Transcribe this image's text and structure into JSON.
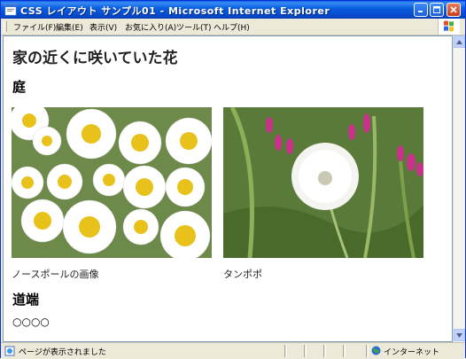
{
  "window": {
    "title": "CSS レイアウト サンプル01 - Microsoft Internet Explorer"
  },
  "menu": {
    "items": [
      "ファイル(F)",
      "編集(E)",
      "表示(V)",
      "お気に入り(A)",
      "ツール(T)",
      "ヘルプ(H)"
    ]
  },
  "page": {
    "title": "家の近くに咲いていた花",
    "section1": "庭",
    "photos": [
      {
        "caption": "ノースポールの画像",
        "icon": "daisy-flowers-photo"
      },
      {
        "caption": "タンポポ",
        "icon": "dandelion-photo"
      }
    ],
    "section2": "道端",
    "circles": "○○○○"
  },
  "status": {
    "text": "ページが表示されました",
    "zone": "インターネット"
  },
  "colors": {
    "titlebar": "#0a5fe0",
    "close": "#c8401c"
  }
}
